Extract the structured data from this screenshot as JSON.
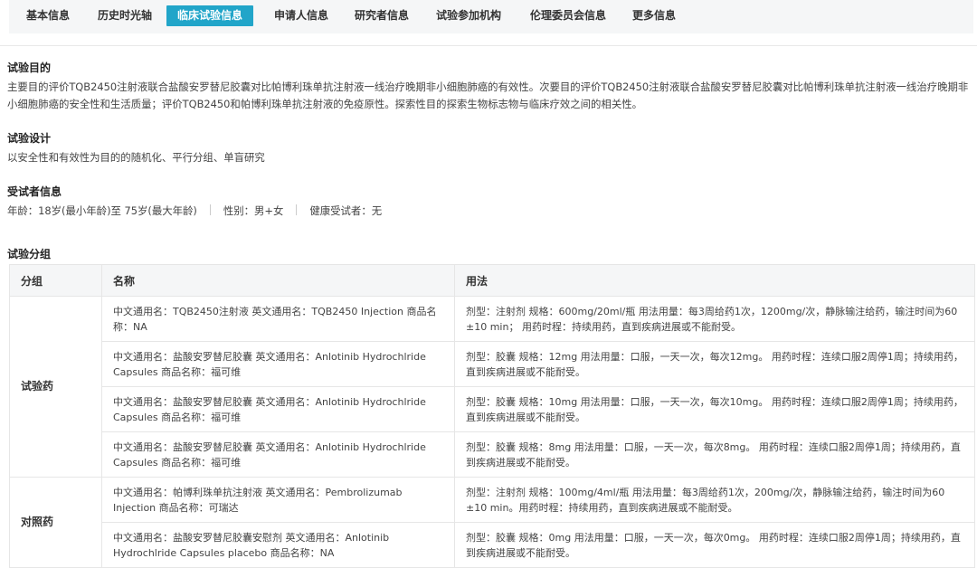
{
  "tabs": [
    {
      "label": "基本信息",
      "active": false
    },
    {
      "label": "历史时光轴",
      "active": false
    },
    {
      "label": "临床试验信息",
      "active": true
    },
    {
      "label": "申请人信息",
      "active": false
    },
    {
      "label": "研究者信息",
      "active": false
    },
    {
      "label": "试验参加机构",
      "active": false
    },
    {
      "label": "伦理委员会信息",
      "active": false
    },
    {
      "label": "更多信息",
      "active": false
    }
  ],
  "purpose": {
    "title": "试验目的",
    "text": "主要目的评价TQB2450注射液联合盐酸安罗替尼胶囊对比帕博利珠单抗注射液一线治疗晚期非小细胞肺癌的有效性。次要目的评价TQB2450注射液联合盐酸安罗替尼胶囊对比帕博利珠单抗注射液一线治疗晚期非小细胞肺癌的安全性和生活质量；评价TQB2450和帕博利珠单抗注射液的免疫原性。探索性目的探索生物标志物与临床疗效之间的相关性。"
  },
  "design": {
    "title": "试验设计",
    "text": "以安全性和有效性为目的的随机化、平行分组、单盲研究"
  },
  "subjects": {
    "title": "受试者信息",
    "age": "年龄：18岁(最小年龄)至 75岁(最大年龄)",
    "gender": "性别：男+女",
    "healthy": "健康受试者：无"
  },
  "groups": {
    "title": "试验分组",
    "headers": {
      "group": "分组",
      "name": "名称",
      "usage": "用法"
    },
    "test": {
      "label": "试验药",
      "rows": [
        {
          "name": "中文通用名：TQB2450注射液 英文通用名：TQB2450 Injection 商品名称：NA",
          "usage": "剂型：注射剂 规格：600mg/20ml/瓶 用法用量：每3周给药1次，1200mg/次，静脉输注给药，输注时间为60 ±10 min； 用药时程：持续用药，直到疾病进展或不能耐受。"
        },
        {
          "name": "中文通用名：盐酸安罗替尼胶囊 英文通用名：Anlotinib Hydrochlride Capsules 商品名称：福可维",
          "usage": "剂型：胶囊 规格：12mg 用法用量：口服，一天一次，每次12mg。 用药时程：连续口服2周停1周；持续用药，直到疾病进展或不能耐受。"
        },
        {
          "name": "中文通用名：盐酸安罗替尼胶囊 英文通用名：Anlotinib Hydrochlride Capsules 商品名称：福可维",
          "usage": "剂型：胶囊 规格：10mg 用法用量：口服，一天一次，每次10mg。 用药时程：连续口服2周停1周；持续用药，直到疾病进展或不能耐受。"
        },
        {
          "name": "中文通用名：盐酸安罗替尼胶囊 英文通用名：Anlotinib Hydrochlride Capsules 商品名称：福可维",
          "usage": "剂型：胶囊 规格：8mg 用法用量：口服，一天一次，每次8mg。 用药时程：连续口服2周停1周；持续用药，直到疾病进展或不能耐受。"
        }
      ]
    },
    "control": {
      "label": "对照药",
      "rows": [
        {
          "name": "中文通用名：帕博利珠单抗注射液 英文通用名：Pembrolizumab Injection 商品名称：可瑞达",
          "usage": "剂型：注射剂 规格：100mg/4ml/瓶 用法用量：每3周给药1次，200mg/次，静脉输注给药，输注时间为60 ±10 min。用药时程：持续用药，直到疾病进展或不能耐受。"
        },
        {
          "name": "中文通用名：盐酸安罗替尼胶囊安慰剂 英文通用名：Anlotinib Hydrochlride Capsules placebo 商品名称：NA",
          "usage": "剂型：胶囊 规格：0mg 用法用量：口服，一天一次，每次0mg。 用药时程：连续口服2周停1周；持续用药，直到疾病进展或不能耐受。"
        }
      ]
    }
  }
}
